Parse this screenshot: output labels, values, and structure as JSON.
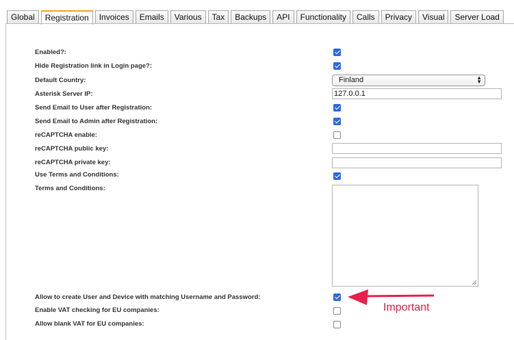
{
  "tabs": [
    {
      "label": "Global",
      "active": false
    },
    {
      "label": "Registration",
      "active": true
    },
    {
      "label": "Invoices",
      "active": false
    },
    {
      "label": "Emails",
      "active": false
    },
    {
      "label": "Various",
      "active": false
    },
    {
      "label": "Tax",
      "active": false
    },
    {
      "label": "Backups",
      "active": false
    },
    {
      "label": "API",
      "active": false
    },
    {
      "label": "Functionality",
      "active": false
    },
    {
      "label": "Calls",
      "active": false
    },
    {
      "label": "Privacy",
      "active": false
    },
    {
      "label": "Visual",
      "active": false
    },
    {
      "label": "Server Load",
      "active": false
    }
  ],
  "fields": {
    "enabled": {
      "label": "Enabled?:",
      "checked": true
    },
    "hide_registration_link": {
      "label": "Hide Registration link in Login page?:",
      "checked": true
    },
    "default_country": {
      "label": "Default Country:",
      "value": "Finland"
    },
    "asterisk_server_ip": {
      "label": "Asterisk Server IP:",
      "value": "127.0.0.1"
    },
    "send_email_user": {
      "label": "Send Email to User after Registration:",
      "checked": true
    },
    "send_email_admin": {
      "label": "Send Email to Admin after Registration:",
      "checked": true
    },
    "recaptcha_enable": {
      "label": "reCAPTCHA enable:",
      "checked": false
    },
    "recaptcha_public_key": {
      "label": "reCAPTCHA public key:",
      "value": ""
    },
    "recaptcha_private_key": {
      "label": "reCAPTCHA private key:",
      "value": ""
    },
    "use_terms": {
      "label": "Use Terms and Conditions:",
      "checked": true
    },
    "terms_text": {
      "label": "Terms and Conditions:",
      "value": ""
    },
    "allow_matching_credentials": {
      "label": "Allow to create User and Device with matching Username and Password:",
      "checked": true
    },
    "vat_checking_eu": {
      "label": "Enable VAT checking for EU companies:",
      "checked": false
    },
    "blank_vat_eu": {
      "label": "Allow blank VAT for EU companies:",
      "checked": false
    }
  },
  "annotation": {
    "text": "Important",
    "color": "#e8214b"
  },
  "colors": {
    "accent_tab": "#f5a623",
    "checkbox": "#2f6ae6"
  }
}
